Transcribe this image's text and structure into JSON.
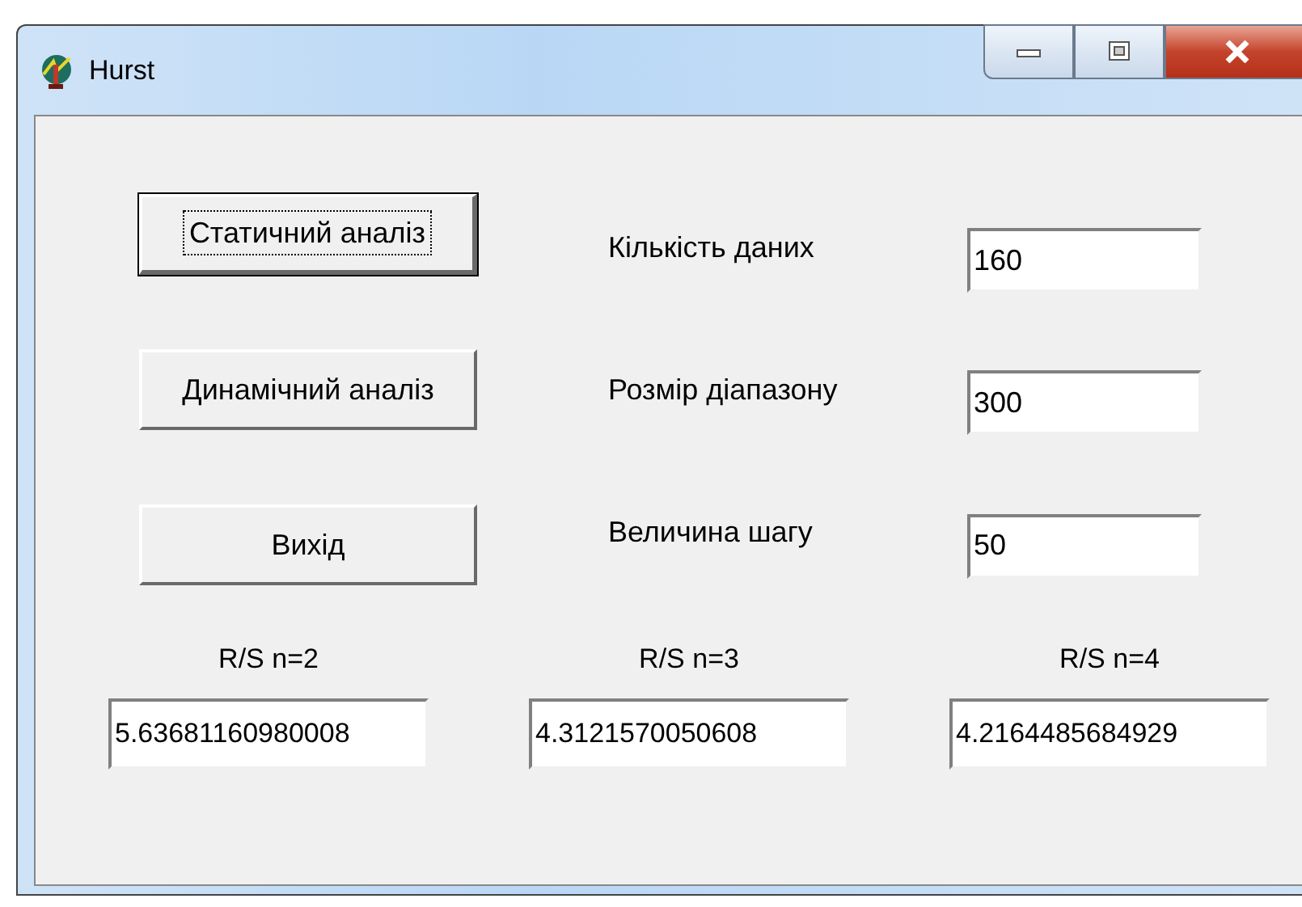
{
  "window": {
    "title": "Hurst"
  },
  "buttons": [
    {
      "label": "Статичний аналіз",
      "focused": true
    },
    {
      "label": "Динамічний аналіз",
      "focused": false
    },
    {
      "label": "Вихід",
      "focused": false
    }
  ],
  "fields": [
    {
      "label": "Кількість даних",
      "value": "160"
    },
    {
      "label": "Розмір діапазону",
      "value": "300"
    },
    {
      "label": "Величина шагу",
      "value": "50"
    }
  ],
  "results": [
    {
      "label": "R/S n=2",
      "value": "5.63681160980008"
    },
    {
      "label": "R/S n=3",
      "value": "4.3121570050608"
    },
    {
      "label": "R/S n=4",
      "value": "4.2164485684929"
    }
  ]
}
